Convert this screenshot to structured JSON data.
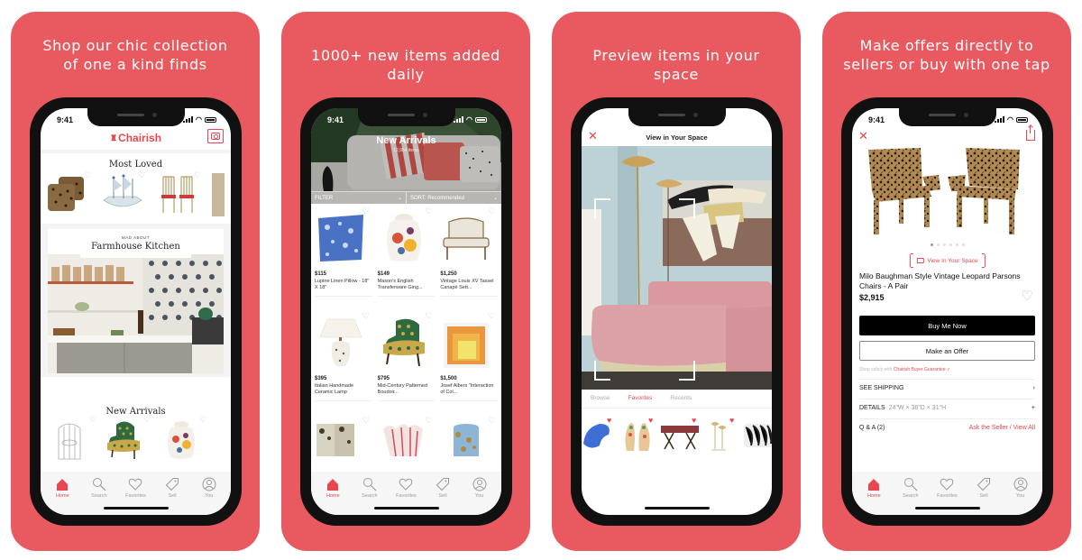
{
  "brand": {
    "accent": "#E85A5F",
    "app_red": "#E8474F"
  },
  "status_bar": {
    "time": "9:41"
  },
  "tab_bar": {
    "items": [
      {
        "label": "Home",
        "icon": "home-icon"
      },
      {
        "label": "Search",
        "icon": "search-icon"
      },
      {
        "label": "Favorites",
        "icon": "heart-icon"
      },
      {
        "label": "Sell",
        "icon": "tag-icon"
      },
      {
        "label": "You",
        "icon": "user-icon"
      }
    ],
    "active": "Home"
  },
  "panels": [
    {
      "caption": "Shop our chic collection\nof one a kind finds",
      "screen": {
        "logo": "Chairish",
        "logo_mark": "♜",
        "sections": [
          {
            "title": "Most Loved",
            "items": [
              "Leopard Pillows",
              "Ship Sculpture",
              "Red Gilt Chairs"
            ]
          },
          {
            "kicker": "MAD ABOUT",
            "title": "Farmhouse Kitchen"
          },
          {
            "title": "New Arrivals",
            "items": [
              "Birdcage Chandelier",
              "Patterned Slipper Chair",
              "Ginger Jar"
            ]
          }
        ]
      }
    },
    {
      "caption": "1000+ new items added daily",
      "screen": {
        "hero_title": "New Arrivals",
        "hero_count": "12,954 items",
        "filter_label": "FILTER",
        "sort_label": "SORT: Recommended",
        "products": [
          {
            "price": "$115",
            "name": "Lupine Linen Pillow - 18\" X 18\""
          },
          {
            "price": "$149",
            "name": "Mason's English Transferware Ging..."
          },
          {
            "price": "$1,250",
            "name": "Vintage Louis XV Tassel Canapé Sett..."
          },
          {
            "price": "$395",
            "name": "Italian Handmade Ceramic Lamp"
          },
          {
            "price": "$795",
            "name": "Mid-Century Patterned Boudoir..."
          },
          {
            "price": "$1,500",
            "name": "Josef Albers \"Interaction of Col..."
          }
        ]
      }
    },
    {
      "caption": "Preview items in your space",
      "screen": {
        "title": "View in Your Space",
        "tabs": [
          "Browse",
          "Favorites",
          "Recents"
        ],
        "active_tab": "Favorites"
      }
    },
    {
      "caption": "Make offers directly to\nsellers or buy with one tap",
      "screen": {
        "view_in_space": "View In Your Space",
        "product_title": "Milo Baughman Style Vintage Leopard Parsons Chairs - A Pair",
        "price": "$2,915",
        "buy_label": "Buy Me Now",
        "offer_label": "Make an Offer",
        "guarantee_prefix": "Shop safely with",
        "guarantee_link": "Chairish Buyer Guarantee ✓",
        "image_count": 6,
        "image_index": 1,
        "rows": {
          "shipping": "SEE SHIPPING",
          "details_label": "DETAILS",
          "details_value": "24\"W × 36\"D × 31\"H",
          "qa_label": "Q & A (2)",
          "qa_link": "Ask the Seller / View All"
        }
      }
    }
  ]
}
